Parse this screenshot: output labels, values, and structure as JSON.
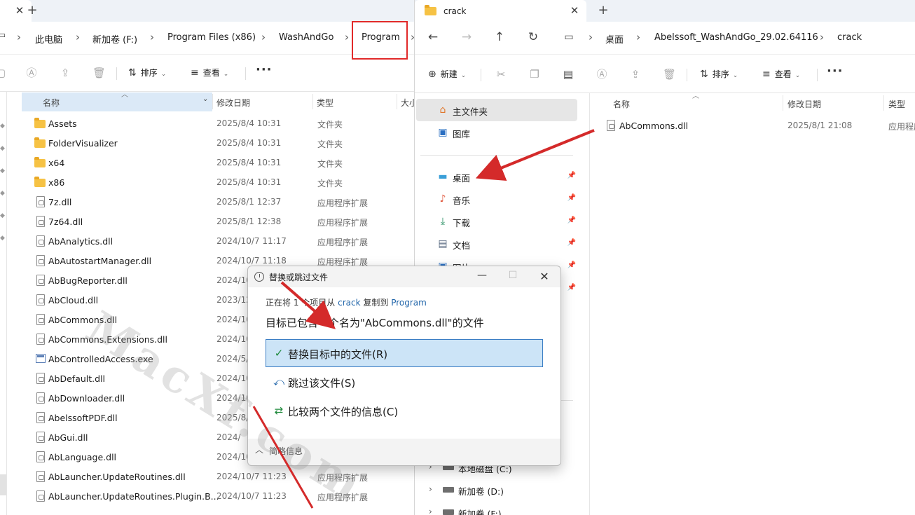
{
  "left_window": {
    "tab": {
      "close_glyph": "✕",
      "new_tab_glyph": "+"
    },
    "breadcrumb": [
      "此电脑",
      "新加卷 (F:)",
      "Program Files (x86)",
      "WashAndGo",
      "Program"
    ],
    "toolbar": {
      "sort": "排序",
      "view": "查看",
      "more": "···"
    },
    "columns": {
      "name": "名称",
      "modified": "修改日期",
      "type": "类型",
      "size": "大小"
    },
    "files": [
      {
        "name": "Assets",
        "date": "2025/8/4 10:31",
        "type": "文件夹",
        "kind": "folder"
      },
      {
        "name": "FolderVisualizer",
        "date": "2025/8/4 10:31",
        "type": "文件夹",
        "kind": "folder"
      },
      {
        "name": "x64",
        "date": "2025/8/4 10:31",
        "type": "文件夹",
        "kind": "folder"
      },
      {
        "name": "x86",
        "date": "2025/8/4 10:31",
        "type": "文件夹",
        "kind": "folder"
      },
      {
        "name": "7z.dll",
        "date": "2025/8/1 12:37",
        "type": "应用程序扩展",
        "kind": "dll"
      },
      {
        "name": "7z64.dll",
        "date": "2025/8/1 12:38",
        "type": "应用程序扩展",
        "kind": "dll"
      },
      {
        "name": "AbAnalytics.dll",
        "date": "2024/10/7 11:17",
        "type": "应用程序扩展",
        "kind": "dll"
      },
      {
        "name": "AbAutostartManager.dll",
        "date": "2024/10/7 11:18",
        "type": "应用程序扩展",
        "kind": "dll"
      },
      {
        "name": "AbBugReporter.dll",
        "date": "2024/10",
        "type": "",
        "kind": "dll"
      },
      {
        "name": "AbCloud.dll",
        "date": "2023/12",
        "type": "",
        "kind": "dll"
      },
      {
        "name": "AbCommons.dll",
        "date": "2024/10",
        "type": "",
        "kind": "dll"
      },
      {
        "name": "AbCommons.Extensions.dll",
        "date": "2024/10",
        "type": "",
        "kind": "dll"
      },
      {
        "name": "AbControlledAccess.exe",
        "date": "2024/5/",
        "type": "",
        "kind": "exe"
      },
      {
        "name": "AbDefault.dll",
        "date": "2024/10",
        "type": "",
        "kind": "dll"
      },
      {
        "name": "AbDownloader.dll",
        "date": "2024/10",
        "type": "",
        "kind": "dll"
      },
      {
        "name": "AbelssoftPDF.dll",
        "date": "2025/8/",
        "type": "",
        "kind": "dll"
      },
      {
        "name": "AbGui.dll",
        "date": "2024/",
        "type": "",
        "kind": "dll"
      },
      {
        "name": "AbLanguage.dll",
        "date": "2024/10",
        "type": "",
        "kind": "dll"
      },
      {
        "name": "AbLauncher.UpdateRoutines.dll",
        "date": "2024/10/7 11:23",
        "type": "应用程序扩展",
        "kind": "dll"
      },
      {
        "name": "AbLauncher.UpdateRoutines.Plugin.B...",
        "date": "2024/10/7 11:23",
        "type": "应用程序扩展",
        "kind": "dll"
      }
    ]
  },
  "right_window": {
    "tab": {
      "title": "crack",
      "close_glyph": "✕",
      "new_tab_glyph": "+"
    },
    "breadcrumb": [
      "桌面",
      "Abelssoft_WashAndGo_29.02.64116",
      "crack"
    ],
    "toolbar": {
      "new": "新建",
      "sort": "排序",
      "view": "查看",
      "more": "···"
    },
    "sidebar": {
      "home": "主文件夹",
      "gallery": "图库",
      "pinned": [
        "桌面",
        "音乐",
        "下载",
        "文档",
        "图片"
      ],
      "drives": [
        "本地磁盘 (C:)",
        "新加卷 (D:)",
        "新加卷 (F:)"
      ]
    },
    "columns": {
      "name": "名称",
      "modified": "修改日期",
      "type": "类型"
    },
    "files": [
      {
        "name": "AbCommons.dll",
        "date": "2025/8/1 21:08",
        "type": "应用程序"
      }
    ]
  },
  "dialog": {
    "title": "替换或跳过文件",
    "subtitle_prefix": "正在将 1 个项目从",
    "source": "crack",
    "subtitle_mid": "复制到",
    "destination": "Program",
    "message": "目标已包含一个名为\"AbCommons.dll\"的文件",
    "options": [
      {
        "label": "替换目标中的文件(R)",
        "icon": "check-icon"
      },
      {
        "label": "跳过该文件(S)",
        "icon": "skip-icon"
      },
      {
        "label": "比较两个文件的信息(C)",
        "icon": "compare-icon"
      }
    ],
    "footer": "简略信息"
  },
  "watermark": "MacXf.com",
  "colors": {
    "highlight_box": "#e12a2a",
    "arrow": "#d42a2a",
    "selected_option": "#cce4f7",
    "link": "#2266aa",
    "folder": "#f6c244"
  }
}
